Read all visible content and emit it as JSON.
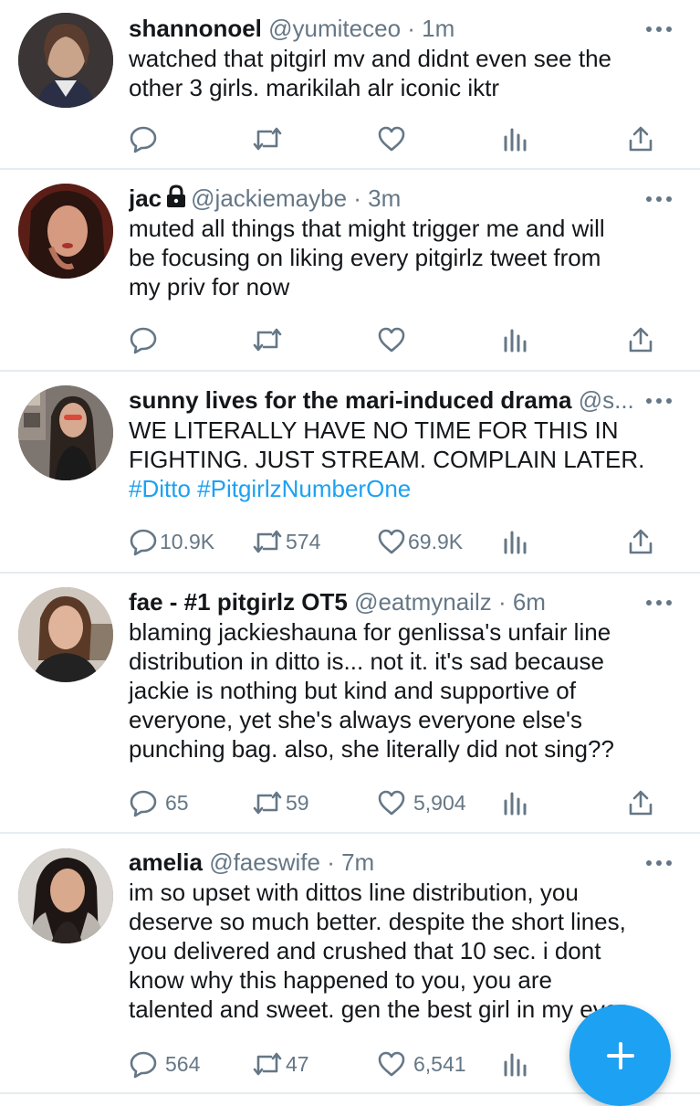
{
  "tweets": [
    {
      "name": "shannonoel",
      "handle": "@yumiteceo",
      "time": "· 1m",
      "lines": [
        "watched that pitgirl mv and didnt even see the",
        "other 3 girls. marikilah alr iconic iktr"
      ],
      "hashtags": "",
      "locked": false,
      "reply_count": "",
      "retweet_count": "",
      "like_count": ""
    },
    {
      "name": "jac",
      "handle": "@jackiemaybe",
      "time": "· 3m",
      "lines": [
        "muted all things that might trigger me and will",
        "be focusing on liking every pitgirlz tweet from",
        "my priv for now"
      ],
      "hashtags": "",
      "locked": true,
      "reply_count": "",
      "retweet_count": "",
      "like_count": ""
    },
    {
      "name": "sunny lives for the mari-induced drama",
      "handle": "@s...",
      "time": "",
      "lines": [
        "WE LITERALLY HAVE NO TIME FOR THIS IN",
        "FIGHTING. JUST STREAM. COMPLAIN LATER."
      ],
      "hashtags": "#Ditto #PitgirlzNumberOne",
      "locked": false,
      "reply_count": "10.9K",
      "retweet_count": "574",
      "like_count": "69.9K"
    },
    {
      "name": "fae - #1 pitgirlz OT5",
      "handle": "@eatmynailz",
      "time": "· 6m",
      "lines": [
        "blaming jackieshauna for genlissa's unfair line",
        "distribution in ditto is... not it. it's sad because",
        "jackie is nothing but kind and supportive of",
        "everyone, yet she's always everyone else's",
        "punching bag. also, she literally did not sing??"
      ],
      "hashtags": "",
      "locked": false,
      "reply_count": "65",
      "retweet_count": "59",
      "like_count": "5,904"
    },
    {
      "name": "amelia",
      "handle": "@faeswife",
      "time": "· 7m",
      "lines": [
        "im so upset with dittos line distribution, you",
        "deserve so much better. despite the short lines,",
        "you delivered and crushed that 10 sec. i dont",
        "know why this happened to you, you are",
        "talented and sweet. gen the best girl in my eyes."
      ],
      "hashtags": "",
      "locked": false,
      "reply_count": "564",
      "retweet_count": "47",
      "like_count": "6,541"
    }
  ],
  "icons": {
    "reply": "reply-icon",
    "retweet": "retweet-icon",
    "like": "heart-icon",
    "analytics": "analytics-icon",
    "share": "share-icon",
    "more": "more-options-icon",
    "compose": "compose-plus-icon",
    "lock": "lock-icon"
  },
  "colors": {
    "accent": "#1da1f2",
    "text": "#14171a",
    "secondary": "#657786",
    "divider": "#e6ecf0"
  }
}
